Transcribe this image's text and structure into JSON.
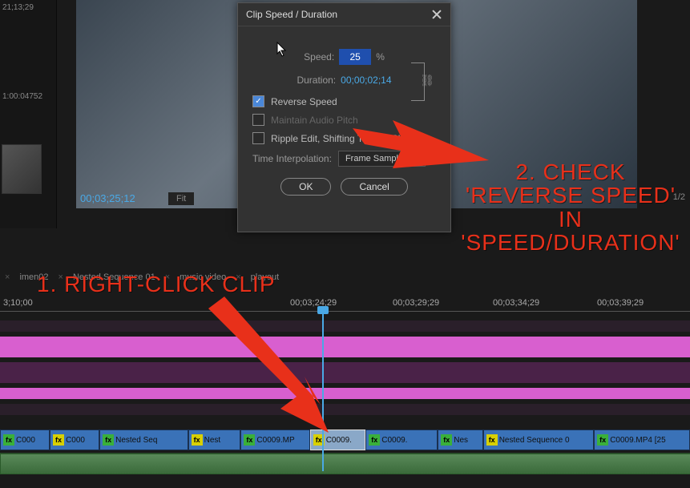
{
  "dialog": {
    "title": "Clip Speed / Duration",
    "speed_label": "Speed:",
    "speed_value": "25",
    "speed_unit": "%",
    "duration_label": "Duration:",
    "duration_value": "00;00;02;14",
    "reverse_label": "Reverse Speed",
    "pitch_label": "Maintain Audio Pitch",
    "ripple_label": "Ripple Edit, Shifting Trailing Clips",
    "interp_label": "Time Interpolation:",
    "interp_value": "Frame Sampling",
    "ok": "OK",
    "cancel": "Cancel"
  },
  "preview": {
    "timecode": "00;03;25;12",
    "fit": "Fit",
    "zoom": "1/2",
    "source_tc": "21;13;29",
    "source_tc2": "1:00:04752"
  },
  "sequences": [
    "imen02",
    "Nested Sequence 01",
    "music video",
    "playout"
  ],
  "ruler": {
    "t0": "3;10;00",
    "t1": "00;03;24;29",
    "t2": "00;03;29;29",
    "t3": "00;03;34;29",
    "t4": "00;03;39;29"
  },
  "clips": [
    {
      "fx": "g",
      "name": "C000"
    },
    {
      "fx": "y",
      "name": "C000"
    },
    {
      "fx": "g",
      "name": "Nested Seq"
    },
    {
      "fx": "y",
      "name": "Nest"
    },
    {
      "fx": "g",
      "name": "C0009.MP"
    },
    {
      "fx": "y",
      "name": "C0009.",
      "selected": true
    },
    {
      "fx": "g",
      "name": "C0009."
    },
    {
      "fx": "g",
      "name": "Nes"
    },
    {
      "fx": "y",
      "name": "Nested Sequence 0"
    },
    {
      "fx": "g",
      "name": "C0009.MP4 [25"
    }
  ],
  "annotations": {
    "step1": "1. Right-click clip",
    "step2a": "2. Check",
    "step2b": "'Reverse Speed'",
    "step2c": "in 'Speed/Duration'"
  }
}
